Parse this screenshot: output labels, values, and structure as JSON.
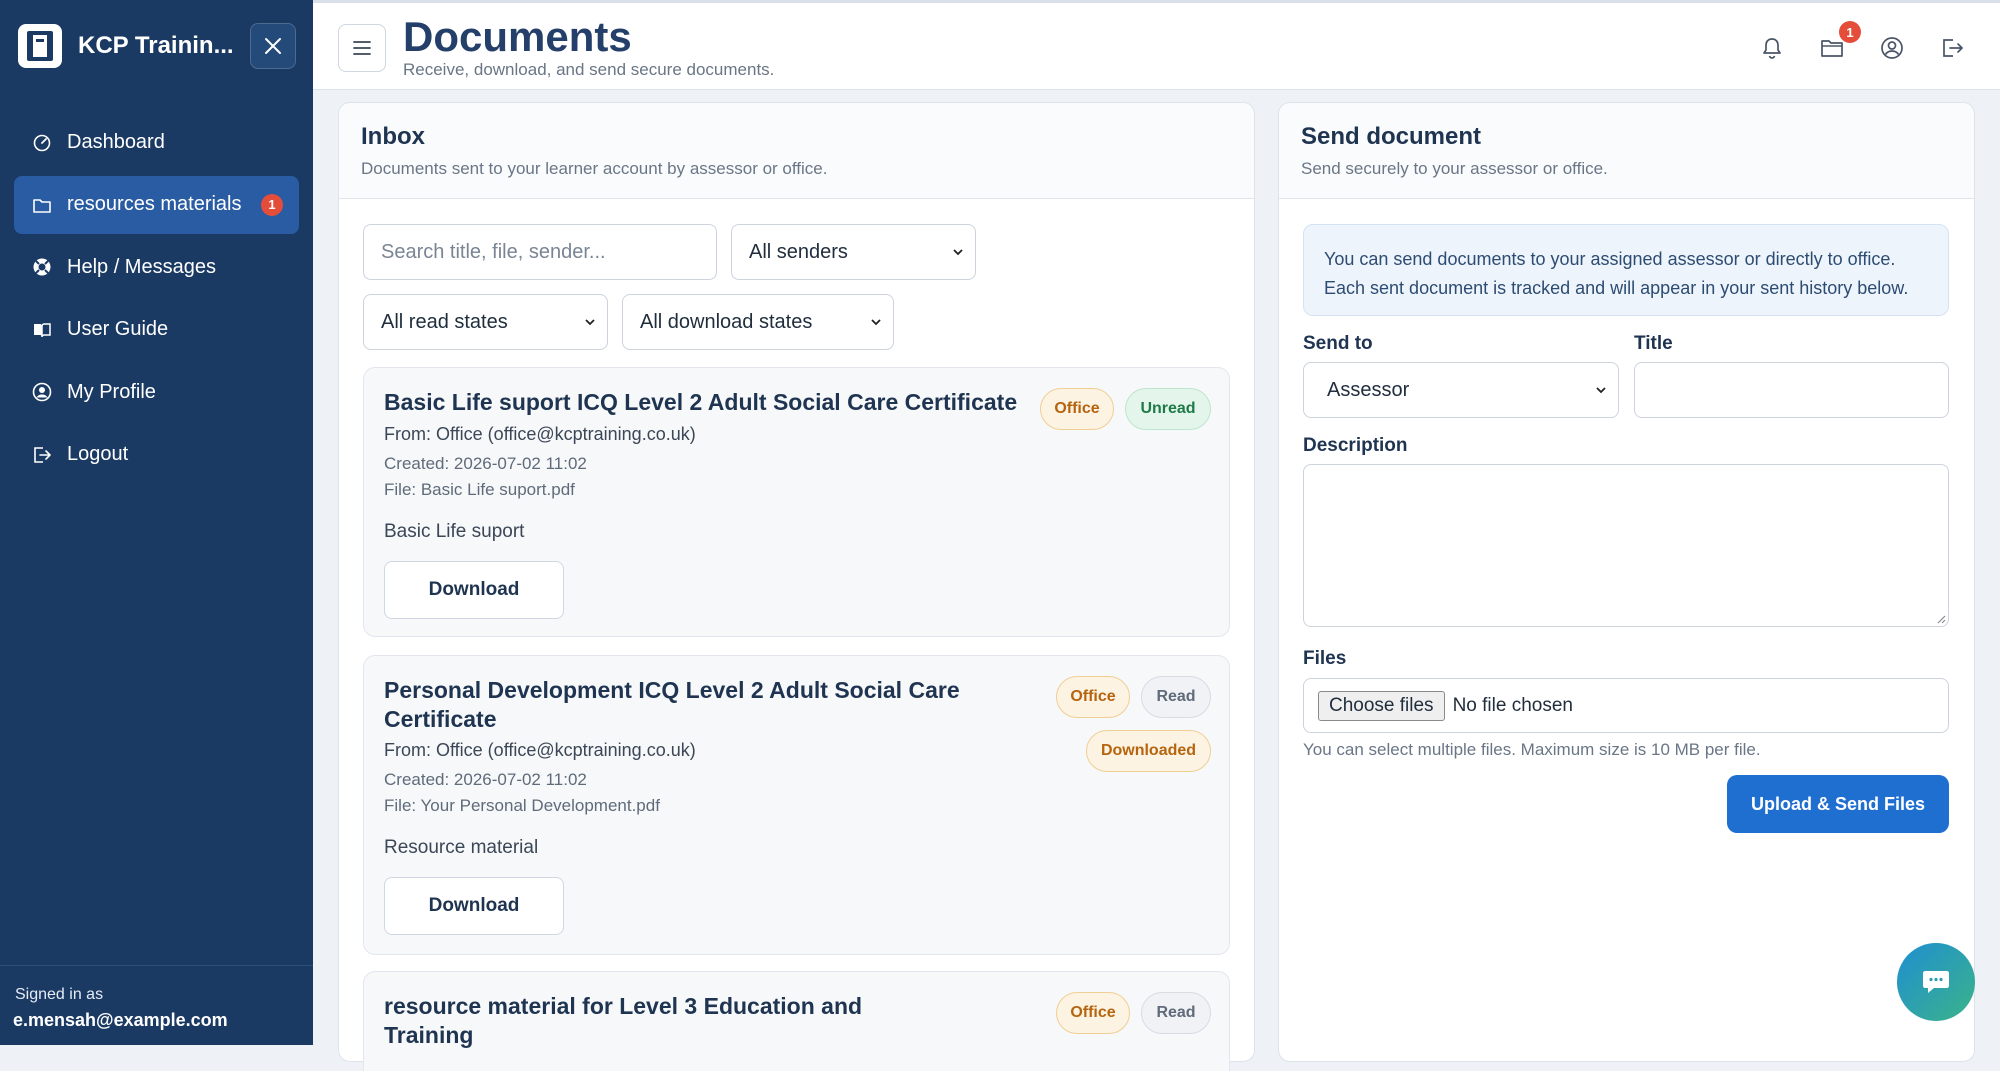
{
  "sidebar": {
    "brand": "KCP Trainin...",
    "items": [
      {
        "label": "Dashboard"
      },
      {
        "label": "resources materials",
        "badge": "1"
      },
      {
        "label": "Help / Messages"
      },
      {
        "label": "User Guide"
      },
      {
        "label": "My Profile"
      },
      {
        "label": "Logout"
      }
    ],
    "signed_label": "Signed in as",
    "signed_email": "e.mensah@example.com"
  },
  "header": {
    "title": "Documents",
    "subtitle": "Receive, download, and send secure documents.",
    "folder_badge": "1"
  },
  "inbox": {
    "title": "Inbox",
    "subtitle": "Documents sent to your learner account by assessor or office.",
    "search_placeholder": "Search title, file, sender...",
    "filter_sender": "All senders",
    "filter_read": "All read states",
    "filter_download": "All download states",
    "documents": [
      {
        "title": "Basic Life suport ICQ Level 2 Adult Social Care Certificate",
        "from": "From: Office (office@kcptraining.co.uk)",
        "created": "Created: 2026-07-02 11:02",
        "file": "File: Basic Life suport.pdf",
        "description": "Basic Life suport",
        "badges": [
          "Office",
          "Unread"
        ],
        "action": "Download"
      },
      {
        "title_line1": "Personal Development ICQ Level 2 Adult Social Care",
        "title_line2": "Certificate",
        "from": "From: Office (office@kcptraining.co.uk)",
        "created": "Created: 2026-07-02 11:02",
        "file": "File: Your Personal Development.pdf",
        "description": "Resource material",
        "badges": [
          "Office",
          "Read",
          "Downloaded"
        ],
        "action": "Download"
      },
      {
        "title_line1": "resource material for Level 3 Education and",
        "title_line2": "Training",
        "badges": [
          "Office",
          "Read"
        ]
      }
    ]
  },
  "send": {
    "title": "Send document",
    "subtitle": "Send securely to your assessor or office.",
    "info": "You can send documents to your assigned assessor or directly to office. Each sent document is tracked and will appear in your sent history below.",
    "send_to_label": "Send to",
    "send_to_value": "Assessor",
    "title_label": "Title",
    "description_label": "Description",
    "files_label": "Files",
    "choose_files": "Choose files",
    "no_file": "No file chosen",
    "hint": "You can select multiple files. Maximum size is 10 MB per file.",
    "submit": "Upload & Send Files"
  }
}
